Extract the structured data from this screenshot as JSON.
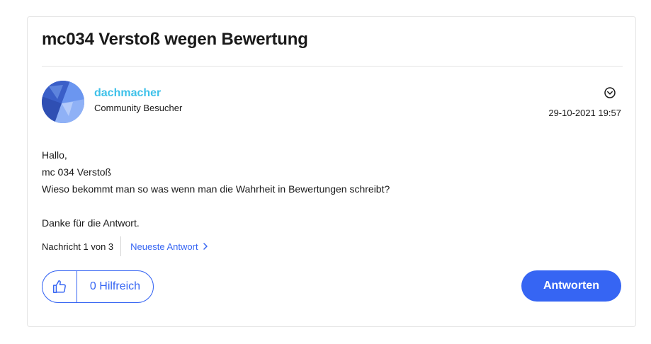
{
  "post": {
    "title": "mc034 Verstoß wegen Bewertung",
    "author": {
      "username": "dachmacher",
      "rank": "Community Besucher",
      "avatar_icon": "avatar-image"
    },
    "menu_icon": "chevron-down-circle-icon",
    "datetime": "29-10-2021 19:57",
    "body": {
      "line1": "Hallo,",
      "line2": "mc 034 Verstoß",
      "line3": "Wieso bekommt man so was wenn man die Wahrheit in Bewertungen schreibt?",
      "line4": "Danke für die Antwort."
    },
    "navigation": {
      "message_count": "Nachricht 1 von 3",
      "newest_reply_label": "Neueste Antwort"
    },
    "kudos": {
      "icon": "thumbs-up-icon",
      "label": "0 Hilfreich"
    },
    "reply_button_label": "Antworten"
  },
  "colors": {
    "accent": "#3665f3",
    "username": "#3ec1e9",
    "text": "#191919",
    "border": "#e5e5e5"
  }
}
